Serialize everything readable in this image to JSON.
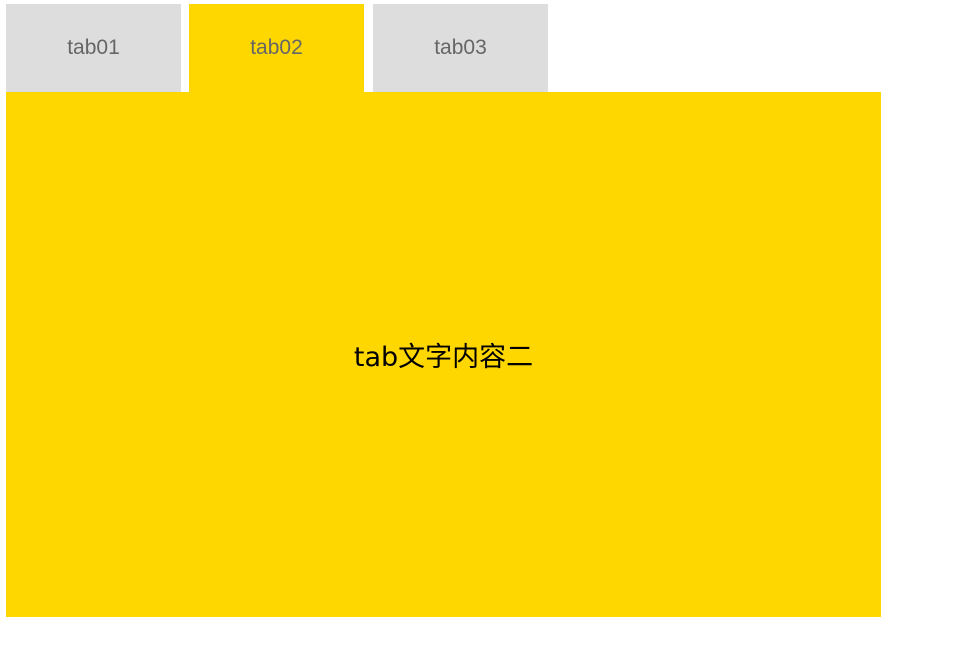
{
  "tabs": [
    {
      "label": "tab01",
      "active": false
    },
    {
      "label": "tab02",
      "active": true
    },
    {
      "label": "tab03",
      "active": false
    }
  ],
  "panel": {
    "content": "tab文字内容二"
  },
  "colors": {
    "active_tab": "#ffd700",
    "inactive_tab": "#dddddd",
    "tab_text": "#666666",
    "panel_background": "#ffd700",
    "panel_text": "#000000"
  }
}
